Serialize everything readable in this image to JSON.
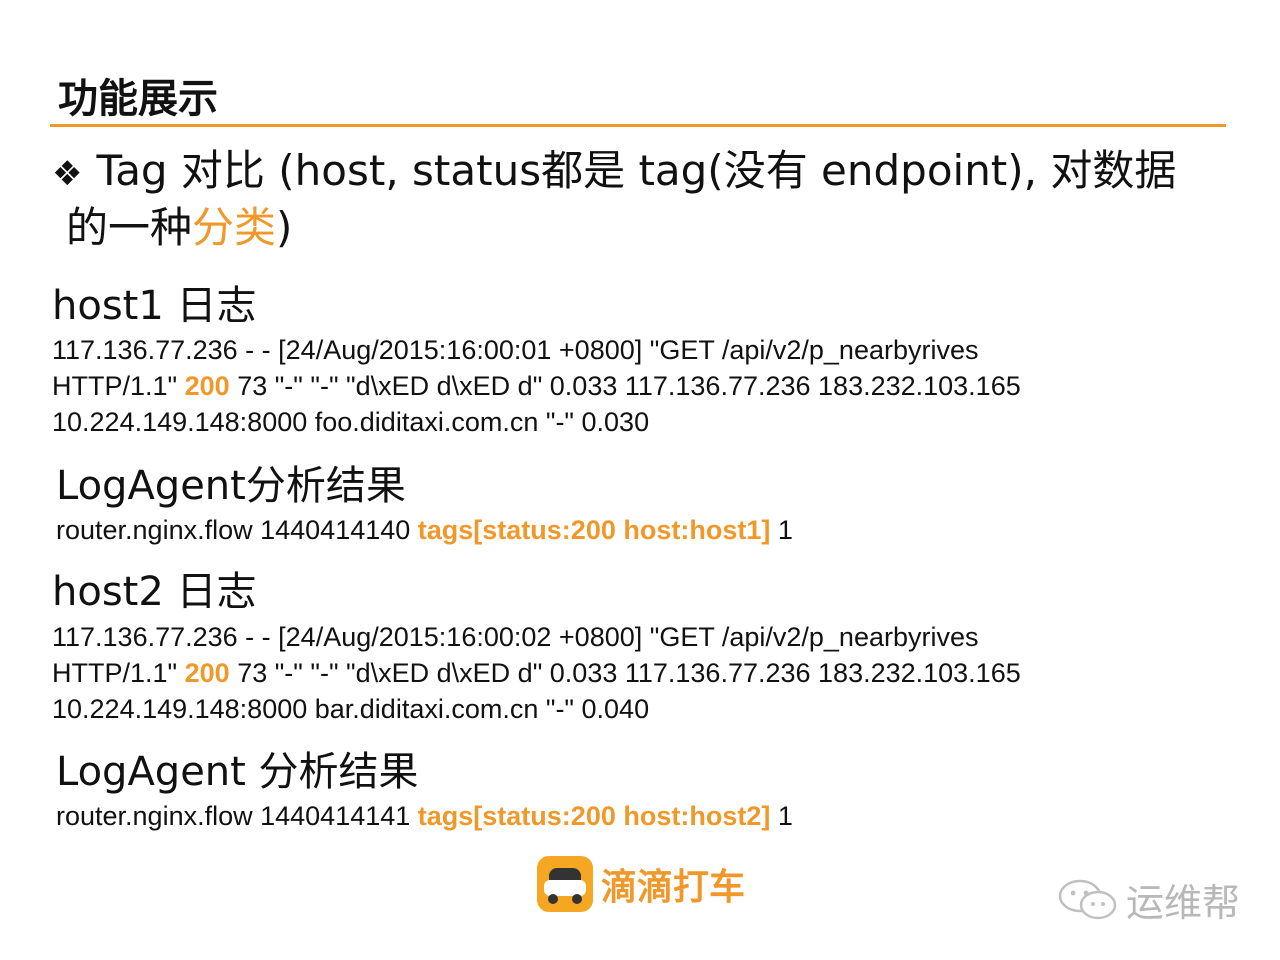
{
  "title": "功能展示",
  "colors": {
    "accent": "#f0982a",
    "text": "#111111",
    "watermark": "#b8b8b8"
  },
  "bullet": {
    "symbol": "❖",
    "text_a": "Tag 对比  (host, status都是 tag(没有 endpoint), 对数据",
    "text_b": "的一种",
    "highlight": "分类",
    "text_c": ")"
  },
  "host1": {
    "heading": "host1 日志",
    "log_line1": "117.136.77.236 - - [24/Aug/2015:16:00:01 +0800] \"GET /api/v2/p_nearbyrives",
    "log_line2_a": "HTTP/1.1\" ",
    "log_status": "200",
    "log_line2_b": " 73 \"-\" \"-\" \"d\\xED d\\xED d\" 0.033 117.136.77.236 183.232.103.165",
    "log_line3": "10.224.149.148:8000 foo.diditaxi.com.cn \"-\" 0.030",
    "result_heading": "LogAgent分析结果",
    "result_prefix": "router.nginx.flow 1440414140 ",
    "result_tags": "tags[status:200 host:host1]",
    "result_suffix": "  1"
  },
  "host2": {
    "heading": "host2 日志",
    "log_line1": "117.136.77.236 - - [24/Aug/2015:16:00:02 +0800] \"GET /api/v2/p_nearbyrives",
    "log_line2_a": "HTTP/1.1\" ",
    "log_status": "200",
    "log_line2_b": " 73 \"-\" \"-\" \"d\\xED d\\xED d\" 0.033 117.136.77.236 183.232.103.165",
    "log_line3": "10.224.149.148:8000 bar.diditaxi.com.cn \"-\" 0.040",
    "result_heading": "LogAgent 分析结果",
    "result_prefix": "router.nginx.flow 1440414141 ",
    "result_tags": "tags[status:200 host:host2]",
    "result_suffix": "  1"
  },
  "logo": {
    "icon": "taxi-car-icon",
    "text": "滴滴打车"
  },
  "watermark": {
    "icon": "wechat-icon",
    "text": "运维帮"
  }
}
